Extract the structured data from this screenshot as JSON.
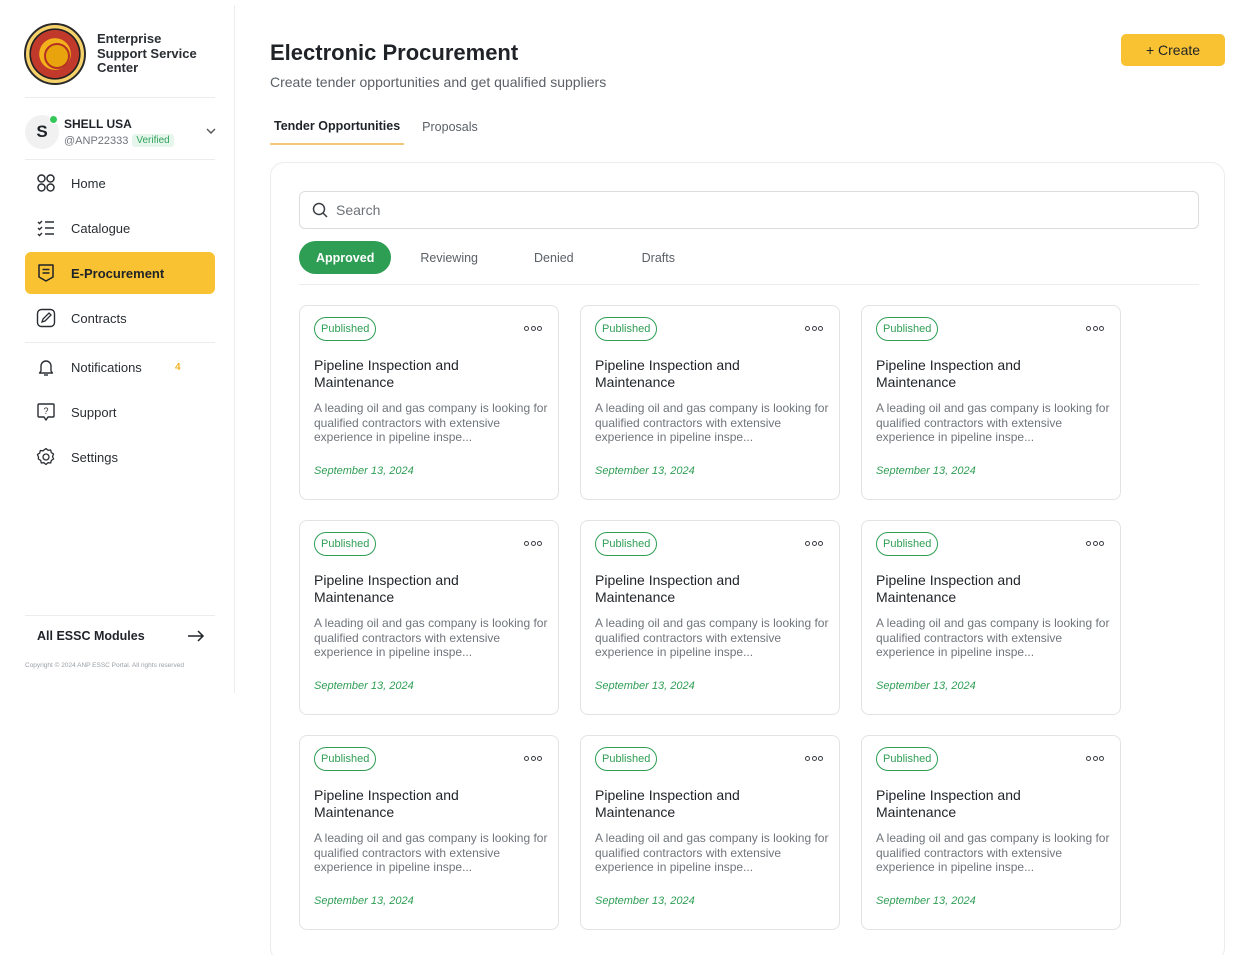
{
  "brand": {
    "name": "Enterprise Support Service Center"
  },
  "account": {
    "initial": "S",
    "name": "SHELL USA",
    "handle": "@ANP22333",
    "verified_label": "Verified"
  },
  "sidebar": {
    "items": [
      {
        "label": "Home",
        "icon": "grid-icon"
      },
      {
        "label": "Catalogue",
        "icon": "list-icon"
      },
      {
        "label": "E-Procurement",
        "icon": "document-icon",
        "active": true
      },
      {
        "label": "Contracts",
        "icon": "pen-icon"
      },
      {
        "label": "Notifications",
        "icon": "bell-icon",
        "badge": "4"
      },
      {
        "label": "Support",
        "icon": "help-icon"
      },
      {
        "label": "Settings",
        "icon": "gear-icon"
      }
    ],
    "modules_label": "All ESSC Modules",
    "copyright": "Copyright © 2024 ANP ESSC Portal. All rights reserved"
  },
  "header": {
    "title": "Electronic Procurement",
    "subtitle": "Create tender opportunities and get qualified suppliers",
    "create_label": "+ Create"
  },
  "tabs": [
    {
      "label": "Tender Opportunities",
      "active": true
    },
    {
      "label": "Proposals"
    }
  ],
  "search": {
    "placeholder": "Search"
  },
  "filters": [
    {
      "label": "Approved",
      "active": true
    },
    {
      "label": "Reviewing"
    },
    {
      "label": "Denied"
    },
    {
      "label": "Drafts"
    }
  ],
  "cards": [
    {
      "status": "Published",
      "title": "Pipeline Inspection and Maintenance",
      "description": "A leading oil and gas company is looking for qualified contractors with extensive experience in pipeline inspe...",
      "date": "September 13, 2024"
    },
    {
      "status": "Published",
      "title": "Pipeline Inspection and Maintenance",
      "description": "A leading oil and gas company is looking for qualified contractors with extensive experience in pipeline inspe...",
      "date": "September 13, 2024"
    },
    {
      "status": "Published",
      "title": "Pipeline Inspection and Maintenance",
      "description": "A leading oil and gas company is looking for qualified contractors with extensive experience in pipeline inspe...",
      "date": "September 13, 2024"
    },
    {
      "status": "Published",
      "title": "Pipeline Inspection and Maintenance",
      "description": "A leading oil and gas company is looking for qualified contractors with extensive experience in pipeline inspe...",
      "date": "September 13, 2024"
    },
    {
      "status": "Published",
      "title": "Pipeline Inspection and Maintenance",
      "description": "A leading oil and gas company is looking for qualified contractors with extensive experience in pipeline inspe...",
      "date": "September 13, 2024"
    },
    {
      "status": "Published",
      "title": "Pipeline Inspection and Maintenance",
      "description": "A leading oil and gas company is looking for qualified contractors with extensive experience in pipeline inspe...",
      "date": "September 13, 2024"
    },
    {
      "status": "Published",
      "title": "Pipeline Inspection and Maintenance",
      "description": "A leading oil and gas company is looking for qualified contractors with extensive experience in pipeline inspe...",
      "date": "September 13, 2024"
    },
    {
      "status": "Published",
      "title": "Pipeline Inspection and Maintenance",
      "description": "A leading oil and gas company is looking for qualified contractors with extensive experience in pipeline inspe...",
      "date": "September 13, 2024"
    },
    {
      "status": "Published",
      "title": "Pipeline Inspection and Maintenance",
      "description": "A leading oil and gas company is looking for qualified contractors with extensive experience in pipeline inspe...",
      "date": "September 13, 2024"
    }
  ],
  "colors": {
    "accent": "#f9c233",
    "success": "#2f9e55"
  }
}
